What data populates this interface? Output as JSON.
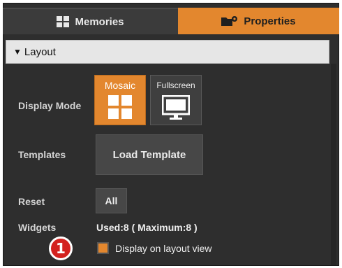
{
  "tabs": {
    "memories_label": "Memories",
    "properties_label": "Properties",
    "active": "properties"
  },
  "layout_section": {
    "title": "Layout",
    "display_mode": {
      "label": "Display Mode",
      "options": [
        "Mosaic",
        "Fullscreen"
      ],
      "selected": "Mosaic"
    },
    "templates": {
      "label": "Templates",
      "button_label": "Load Template"
    },
    "reset": {
      "label": "Reset",
      "button_label": "All"
    },
    "widgets": {
      "label": "Widgets",
      "used_text": "Used:8 ( Maximum:8 )"
    },
    "display_on_layout": {
      "label": "Display on layout view",
      "checked": true
    }
  },
  "callout_number": "1",
  "colors": {
    "accent": "#e3872e",
    "panel_bg": "#2e2e2e",
    "callout": "#d3221f"
  },
  "icons": {
    "memories": "grid-icon",
    "properties": "folder-gear-icon",
    "mosaic": "mosaic-grid-icon",
    "fullscreen": "monitor-icon"
  }
}
